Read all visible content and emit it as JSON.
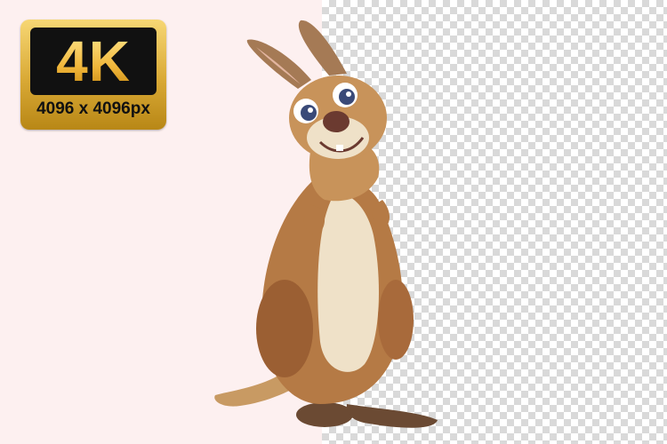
{
  "badge": {
    "title": "4K",
    "resolution": "4096 x 4096px"
  },
  "colors": {
    "left_background": "#fdf0f0",
    "checker_light": "#ffffff",
    "checker_dark": "#d9d9d9",
    "badge_gold": "#d9a935",
    "badge_dark": "#111111"
  },
  "subject": {
    "icon": "kangaroo-illustration"
  }
}
